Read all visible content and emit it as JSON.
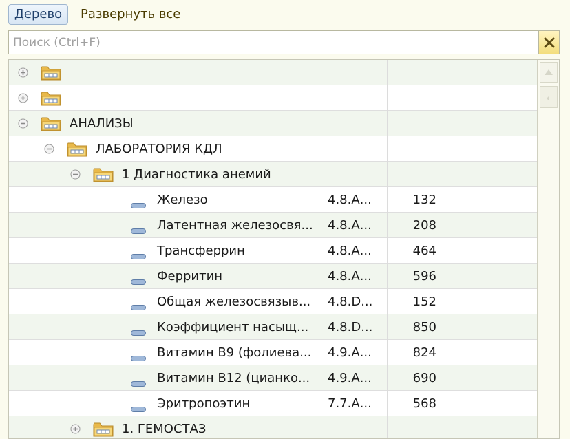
{
  "toolbar": {
    "tree_label": "Дерево",
    "expand_all_label": "Развернуть все"
  },
  "search": {
    "placeholder": "Поиск (Ctrl+F)",
    "value": ""
  },
  "tree": {
    "rows": [
      {
        "type": "group",
        "state": "collapsed",
        "label": "",
        "code": "",
        "count": ""
      },
      {
        "type": "group",
        "state": "collapsed",
        "label": "",
        "code": "",
        "count": ""
      },
      {
        "type": "group",
        "state": "expanded",
        "label": "АНАЛИЗЫ",
        "code": "",
        "count": ""
      },
      {
        "type": "group",
        "state": "expanded",
        "label": "ЛАБОРАТОРИЯ КДЛ",
        "code": "",
        "count": ""
      },
      {
        "type": "group",
        "state": "expanded",
        "label": "1 Диагностика анемий",
        "code": "",
        "count": ""
      },
      {
        "type": "item",
        "label": "Железо",
        "code": "4.8.А...",
        "count": "132"
      },
      {
        "type": "item",
        "label": "Латентная железосвя...",
        "code": "4.8.А...",
        "count": "208"
      },
      {
        "type": "item",
        "label": "Трансферрин",
        "code": "4.8.А...",
        "count": "464"
      },
      {
        "type": "item",
        "label": "Ферритин",
        "code": "4.8.А...",
        "count": "596"
      },
      {
        "type": "item",
        "label": "Общая железосвязыв...",
        "code": "4.8.D...",
        "count": "152"
      },
      {
        "type": "item",
        "label": "Коэффициент насыщ...",
        "code": "4.8.D...",
        "count": "850"
      },
      {
        "type": "item",
        "label": "Витамин В9 (фолиева...",
        "code": "4.9.А...",
        "count": "824"
      },
      {
        "type": "item",
        "label": "Витамин В12 (цианко...",
        "code": "4.9.А...",
        "count": "690"
      },
      {
        "type": "item",
        "label": "Эритропоэтин",
        "code": "7.7.А...",
        "count": "568"
      },
      {
        "type": "group",
        "state": "collapsed",
        "label": "1. ГЕМОСТАЗ",
        "code": "",
        "count": ""
      }
    ]
  },
  "icons": {
    "clear": "close-icon",
    "group_collapsed": "plus-circle-icon",
    "group_expanded": "minus-circle-icon",
    "folder": "folder-icon",
    "item": "item-dash-icon",
    "scroll_up": "arrow-up-icon"
  },
  "colors": {
    "background": "#fbfbee",
    "row_alt": "#f1f6ee",
    "folder": "#f2cf6a",
    "item_icon": "#7f9cc4",
    "clear_button": "#f3de7e"
  }
}
